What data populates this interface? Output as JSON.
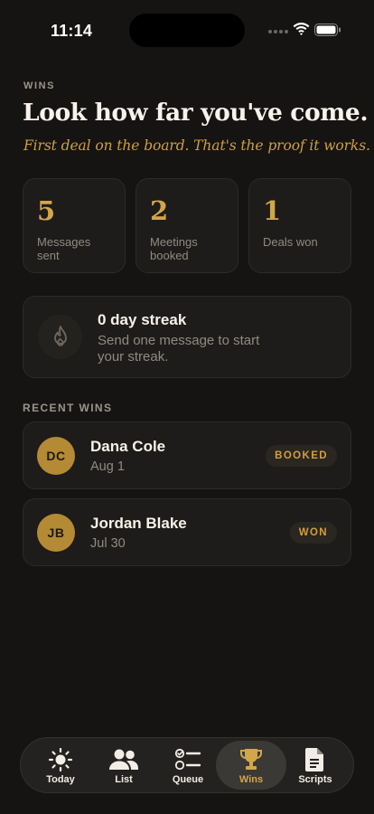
{
  "status": {
    "time": "11:14"
  },
  "header": {
    "eyebrow": "WINS",
    "title": "Look how far you've come.",
    "subtitle": "First deal on the board. That's the proof it works."
  },
  "stats": [
    {
      "value": "5",
      "label": "Messages sent"
    },
    {
      "value": "2",
      "label": "Meetings booked"
    },
    {
      "value": "1",
      "label": "Deals won"
    }
  ],
  "streak": {
    "title": "0 day streak",
    "subtitle": "Send one message to start your streak.",
    "icon": "flame-icon"
  },
  "recent": {
    "label": "RECENT WINS",
    "items": [
      {
        "initials": "DC",
        "name": "Dana Cole",
        "date": "Aug 1",
        "badge": "BOOKED"
      },
      {
        "initials": "JB",
        "name": "Jordan Blake",
        "date": "Jul 30",
        "badge": "WON"
      }
    ]
  },
  "tabs": [
    {
      "label": "Today",
      "icon": "sun-icon",
      "active": false
    },
    {
      "label": "List",
      "icon": "people-icon",
      "active": false
    },
    {
      "label": "Queue",
      "icon": "checklist-icon",
      "active": false
    },
    {
      "label": "Wins",
      "icon": "trophy-icon",
      "active": true
    },
    {
      "label": "Scripts",
      "icon": "document-icon",
      "active": false
    }
  ],
  "colors": {
    "background": "#151413",
    "card": "#1e1c1a",
    "accent": "#d2a64a",
    "muted": "#8f8a82"
  }
}
